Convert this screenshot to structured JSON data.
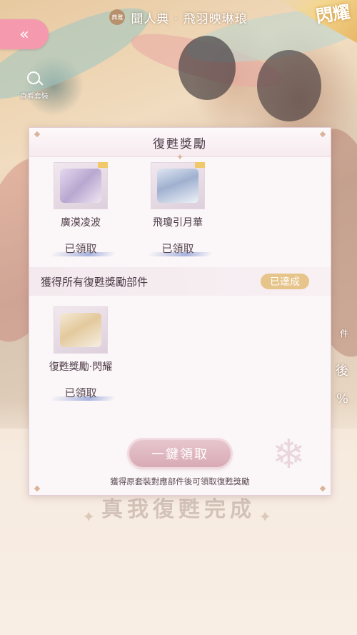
{
  "header": {
    "badge": "典雅",
    "title": "聞人典 · 飛羽映琳琅",
    "corner_tag": "閃耀"
  },
  "nav": {
    "back_symbol": "«",
    "view_outfit_label": "查看套裝"
  },
  "side_labels": [
    "件",
    "後",
    "%"
  ],
  "panel": {
    "title": "復甦獎勵",
    "items": [
      {
        "name": "廣漠凌波",
        "status": "已領取",
        "icon": "scarf-icon"
      },
      {
        "name": "飛瓊引月華",
        "status": "已領取",
        "icon": "dress-icon"
      }
    ],
    "bonus": {
      "label": "獲得所有復甦獎勵部件",
      "status": "已達成",
      "item": {
        "name": "復甦獎勵·閃耀",
        "status": "已領取",
        "icon": "giftbox-icon"
      }
    },
    "claim_all_label": "一鍵領取",
    "hint": "獲得原套裝對應部件後可領取復甦獎勵"
  },
  "footer_watermark": "真我復甦完成",
  "colors": {
    "back_button": "#f59aae",
    "claim_button": "#d8aab5",
    "achieved_badge": "#e6c48a",
    "panel_bg": "#fbf6f7"
  }
}
